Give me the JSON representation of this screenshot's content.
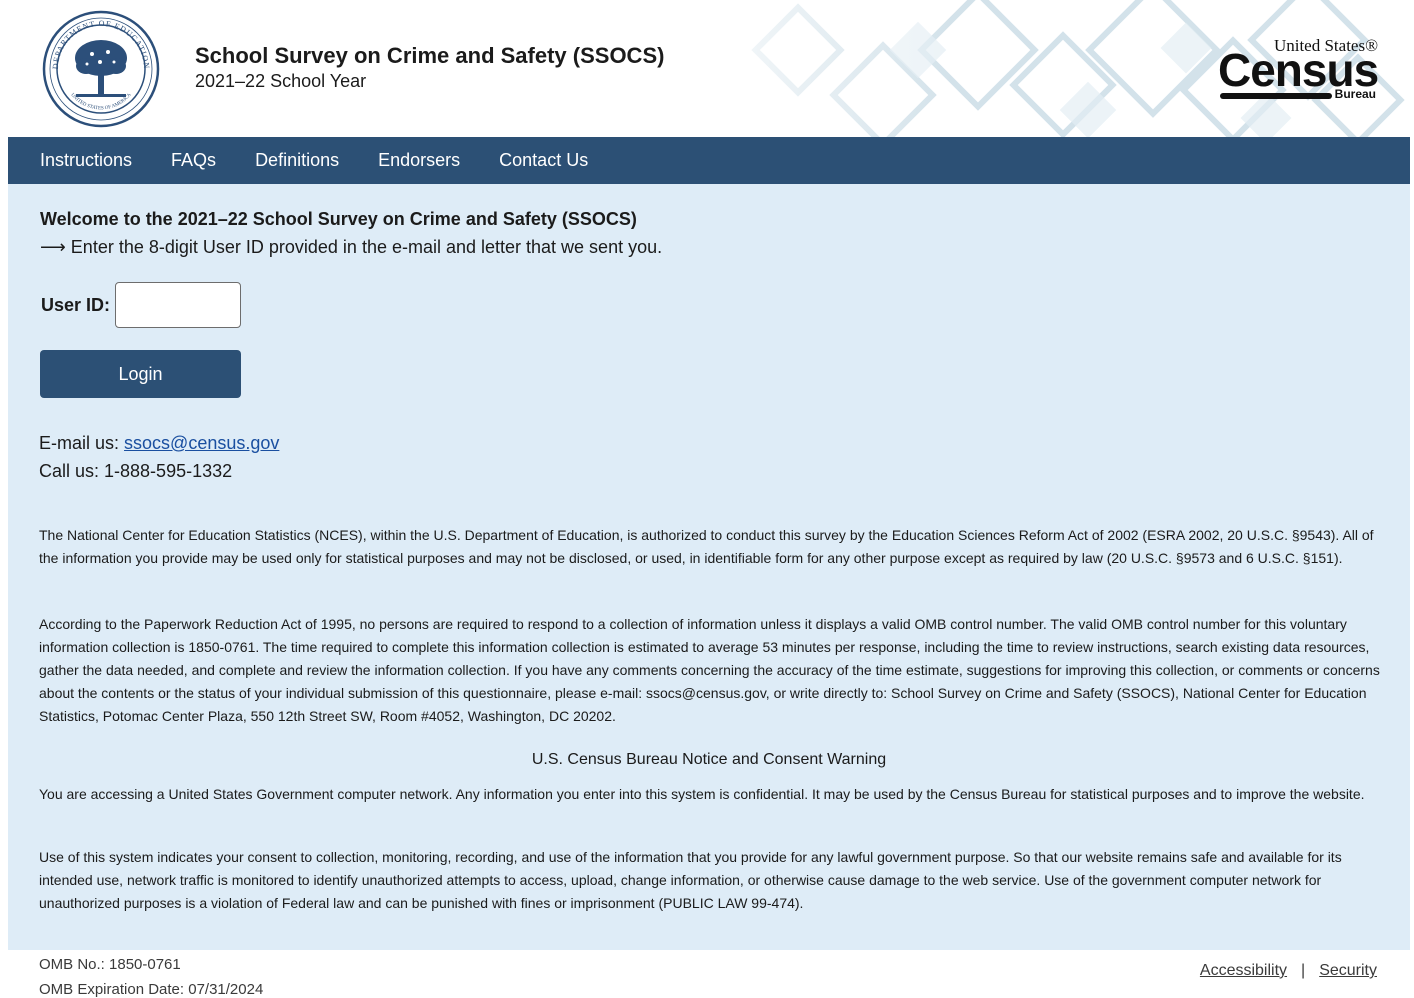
{
  "header": {
    "title": "School Survey on Crime and Safety (SSOCS)",
    "subtitle": "2021–22 School Year",
    "seal_alt": "Department of Education seal",
    "seal_text_top": "DEPARTMENT OF EDUCATION",
    "seal_text_bottom": "UNITED STATES OF AMERICA",
    "census_logo": {
      "top": "United States®",
      "main": "Census",
      "bureau": "Bureau"
    }
  },
  "nav": {
    "items": [
      "Instructions",
      "FAQs",
      "Definitions",
      "Endorsers",
      "Contact Us"
    ]
  },
  "main": {
    "welcome_title": "Welcome to the 2021–22 School Survey on Crime and Safety (SSOCS)",
    "instruction": "⟶ Enter the 8-digit User ID provided in the e-mail and letter that we sent you.",
    "userid_label": "User ID:",
    "userid_value": "",
    "login_label": "Login",
    "email_prefix": "E-mail us: ",
    "email_link": "ssocs@census.gov",
    "phone": "Call us: 1-888-595-1332",
    "para_nces": "The National Center for Education Statistics (NCES), within the U.S. Department of Education, is authorized to conduct this survey by the Education Sciences Reform Act of 2002 (ESRA 2002, 20 U.S.C. §9543). All of the information you provide may be used only for statistical purposes and may not be disclosed, or used, in identifiable form for any other purpose except as required by law (20 U.S.C. §9573 and 6 U.S.C. §151).",
    "para_paperwork": "According to the Paperwork Reduction Act of 1995, no persons are required to respond to a collection of information unless it displays a valid OMB control number. The valid OMB control number for this voluntary information collection is 1850-0761. The time required to complete this information collection is estimated to average 53 minutes per response, including the time to review instructions, search existing data resources, gather the data needed, and complete and review the information collection. If you have any comments concerning the accuracy of the time estimate, suggestions for improving this collection, or comments or concerns about the contents or the status of your individual submission of this questionnaire, please e-mail: ssocs@census.gov, or write directly to: School Survey on Crime and Safety (SSOCS), National Center for Education Statistics, Potomac Center Plaza, 550 12th Street SW, Room #4052, Washington, DC 20202.",
    "notice_title": "U.S. Census Bureau Notice and Consent Warning",
    "para_accessing": "You are accessing a United States Government computer network. Any information you enter into this system is confidential. It may be used by the Census Bureau for statistical purposes and to improve the website.",
    "para_consent": "Use of this system indicates your consent to collection, monitoring, recording, and use of the information that you provide for any lawful government purpose. So that our website remains safe and available for its intended use, network traffic is monitored to identify unauthorized attempts to access, upload, change information, or otherwise cause damage to the web service. Use of the government computer network for unauthorized purposes is a violation of Federal law and can be punished with fines or imprisonment (PUBLIC LAW 99-474)."
  },
  "footer": {
    "omb_no": "OMB No.: 1850-0761",
    "omb_expiration": "OMB Expiration Date: 07/31/2024",
    "accessibility": "Accessibility",
    "separator": "|",
    "security": "Security"
  },
  "colors": {
    "nav_bg": "#2c5075",
    "main_bg": "#deecf7",
    "link": "#1a4fa0"
  }
}
